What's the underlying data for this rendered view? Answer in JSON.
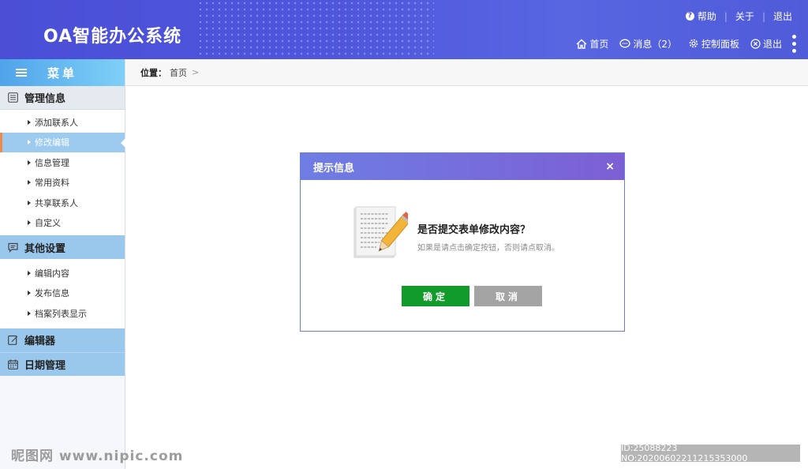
{
  "header": {
    "logo": "OA智能办公系统",
    "toplinks": {
      "help": "帮助",
      "about": "关于",
      "logout": "退出"
    },
    "nav": {
      "home": "首页",
      "messages": "消息（2）",
      "control_panel": "控制面板",
      "exit": "退出"
    }
  },
  "sidebar": {
    "menu_title": "菜单",
    "groups": [
      {
        "label": "管理信息",
        "items": [
          "添加联系人",
          "修改编辑",
          "信息管理",
          "常用资料",
          "共享联系人",
          "自定义"
        ]
      },
      {
        "label": "其他设置",
        "items": [
          "编辑内容",
          "发布信息",
          "档案列表显示"
        ]
      },
      {
        "label": "编辑器"
      },
      {
        "label": "日期管理"
      }
    ]
  },
  "breadcrumb": {
    "label": "位置：",
    "current": "首页",
    "arrow": ">"
  },
  "dialog": {
    "title": "提示信息",
    "close": "×",
    "question": "是否提交表单修改内容？",
    "hint": "如果是请点击确定按钮，否则请点取消。",
    "ok_label": "确定",
    "cancel_label": "取消"
  },
  "watermark": {
    "left": "昵图网 www.nipic.com",
    "right": "ID:25088223 NO:20200602211215353000"
  },
  "colors": {
    "header": "#4e55dc",
    "ok": "#119b2a",
    "cancel": "#a4a4a4",
    "active_item": "#9ccbef",
    "active_marker": "#f08a4b"
  }
}
